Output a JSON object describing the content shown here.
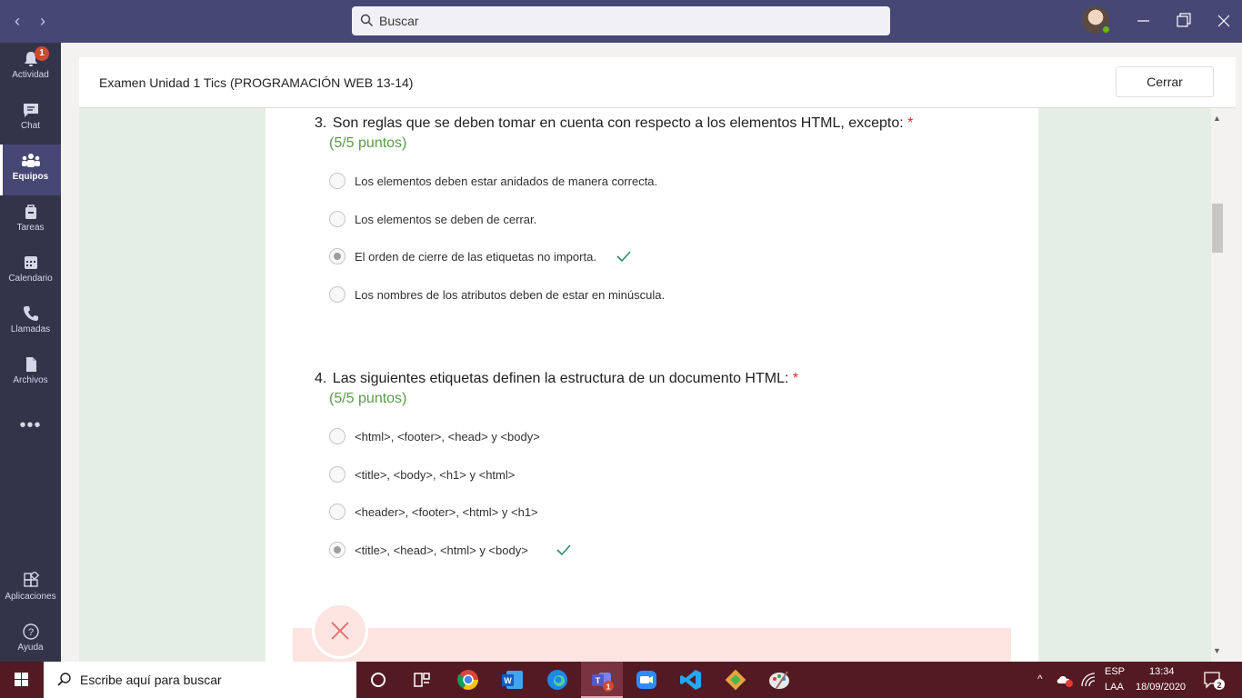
{
  "titlebar": {
    "search_placeholder": "Buscar"
  },
  "rail": {
    "items": [
      {
        "label": "Actividad",
        "badge": "1"
      },
      {
        "label": "Chat"
      },
      {
        "label": "Equipos"
      },
      {
        "label": "Tareas"
      },
      {
        "label": "Calendario"
      },
      {
        "label": "Llamadas"
      },
      {
        "label": "Archivos"
      }
    ],
    "more": "•••",
    "bottom": [
      {
        "label": "Aplicaciones"
      },
      {
        "label": "Ayuda"
      }
    ]
  },
  "header": {
    "title": "Examen Unidad 1 Tics (PROGRAMACIÓN WEB 13-14)",
    "close_label": "Cerrar"
  },
  "questions": [
    {
      "number": "3.",
      "text": "Son reglas que se deben tomar en cuenta con respecto a los elementos HTML, excepto:",
      "required_mark": "*",
      "points": "(5/5 puntos)",
      "options": [
        {
          "text": "Los elementos deben estar anidados de manera correcta.",
          "selected": false,
          "correct": false
        },
        {
          "text": "Los elementos se deben de cerrar.",
          "selected": false,
          "correct": false
        },
        {
          "text": "El orden de cierre de las etiquetas no importa.",
          "selected": true,
          "correct": true
        },
        {
          "text": "Los nombres de los atributos deben de estar en minúscula.",
          "selected": false,
          "correct": false
        }
      ]
    },
    {
      "number": "4.",
      "text": "Las siguientes etiquetas definen la estructura de un documento HTML:",
      "required_mark": "*",
      "points": "(5/5 puntos)",
      "options": [
        {
          "text": "<html>, <footer>, <head> y <body>",
          "selected": false,
          "correct": false
        },
        {
          "text": "<title>, <body>, <h1> y <html>",
          "selected": false,
          "correct": false
        },
        {
          "text": "<header>, <footer>, <html> y <h1>",
          "selected": false,
          "correct": false
        },
        {
          "text": "<title>, <head>, <html> y <body>",
          "selected": true,
          "correct": true
        }
      ]
    }
  ],
  "taskbar": {
    "search_placeholder": "Escribe aquí para buscar",
    "teams_badge": "1",
    "language": "ESP",
    "layout": "LAA",
    "time": "13:34",
    "date": "18/09/2020",
    "notifications": "2"
  },
  "colors": {
    "teams_purple": "#464775",
    "rail": "#33344a",
    "points_green": "#5b9a4a",
    "check_teal": "#2e8b74",
    "required_red": "#d93025",
    "taskbar": "#541a23"
  }
}
